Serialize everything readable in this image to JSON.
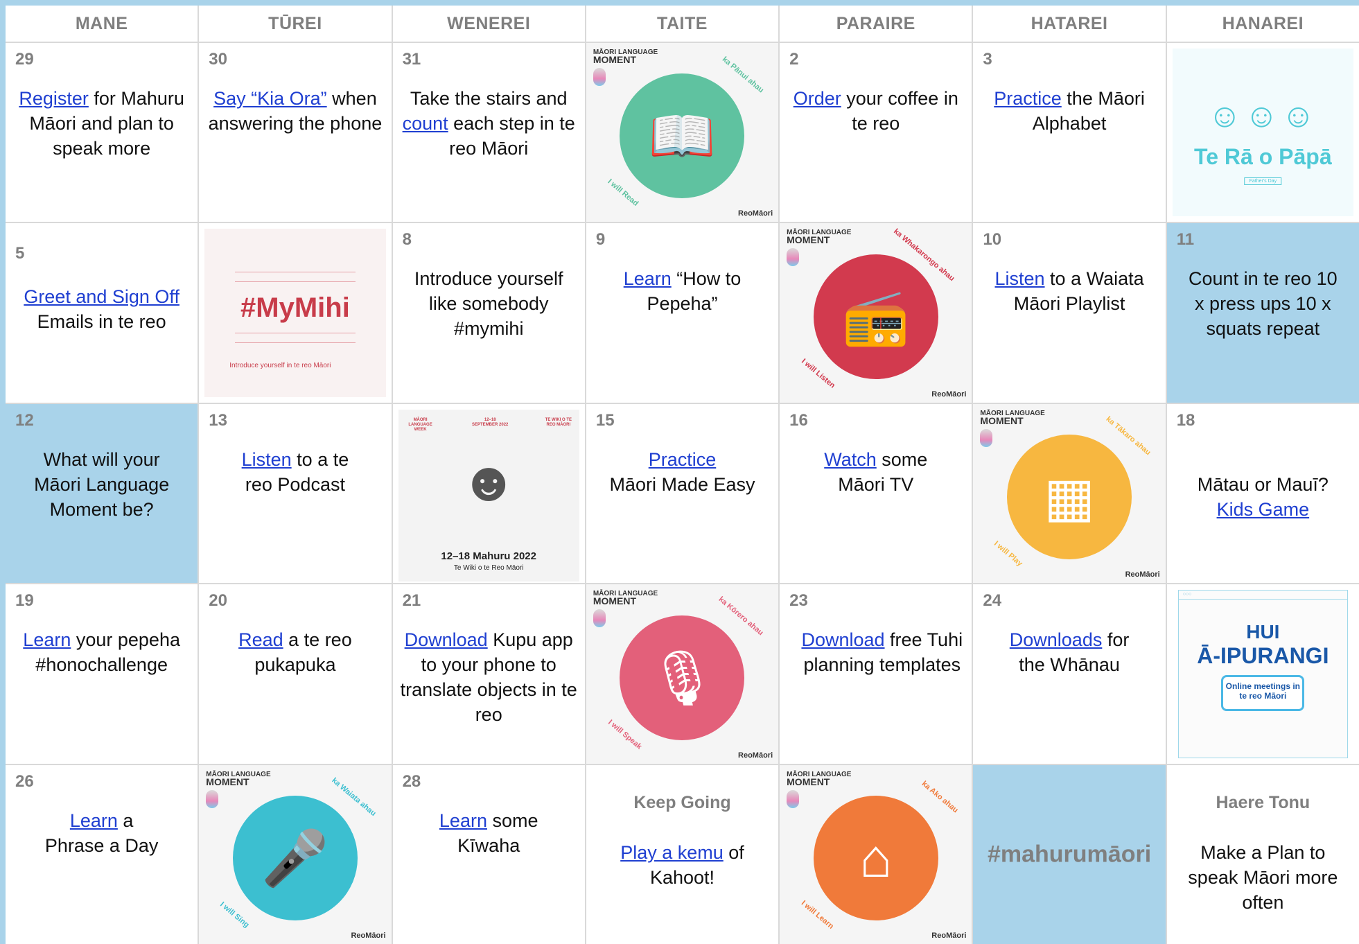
{
  "headers": [
    "MANE",
    "TŪREI",
    "WENEREI",
    "TAITE",
    "PARAIRE",
    "HATAREI",
    "HANAREI"
  ],
  "colors": {
    "accent_blue": "#a9d3ea",
    "link": "#1f3fd1",
    "grey_text": "#7f7f7f"
  },
  "moment": {
    "label_small": "MĀORI LANGUAGE",
    "label_big": "MOMENT",
    "brand": "ReoMāori"
  },
  "cells": {
    "c29": {
      "day": "29",
      "link": "Register",
      "rest": " for Mahuru Māori and plan to speak more"
    },
    "c30": {
      "day": "30",
      "link": "Say “Kia Ora”",
      "rest": " when answering the phone"
    },
    "c31": {
      "day": "31",
      "pre": "Take the stairs and ",
      "link": "count",
      "rest": " each step in te reo Māori"
    },
    "read": {
      "arc1": "ka Pānui ahau",
      "arc2": "I will Read",
      "color": "#5fc2a0",
      "icon": "open-book-icon"
    },
    "c2": {
      "day": "2",
      "link": "Order",
      "rest": " your coffee in te reo"
    },
    "c3": {
      "day": "3",
      "link": "Practice",
      "rest": " the Māori Alphabet"
    },
    "fathers": {
      "title": "Te Rā o Pāpā",
      "sub": "Father's Day"
    },
    "c5": {
      "day": "5",
      "link": "Greet and Sign Off",
      "rest": " Emails in te reo"
    },
    "mihi": {
      "title": "#MyMihi",
      "caption": "Introduce yourself in te reo Māori"
    },
    "c8": {
      "day": "8",
      "text": "Introduce yourself like somebody #mymihi"
    },
    "c9": {
      "day": "9",
      "link": "Learn",
      "rest": " “How to Pepeha”"
    },
    "listen": {
      "arc1": "ka Whakarongo ahau",
      "arc2": "I will Listen",
      "color": "#d23a4e",
      "icon": "radio-icon"
    },
    "c10": {
      "day": "10",
      "link": "Listen",
      "rest": " to a Waiata Māori Playlist"
    },
    "c11": {
      "day": "11",
      "text": "Count in te reo 10 x press ups 10 x squats repeat"
    },
    "c12": {
      "day": "12",
      "text": "What will your Māori Language Moment be?"
    },
    "c13": {
      "day": "13",
      "link": "Listen",
      "rest": " to a te reo Podcast"
    },
    "poster": {
      "top_left": "MĀORI LANGUAGE WEEK",
      "top_mid": "12–18 SEPTEMBER 2022",
      "top_right": "TE WIKI O TE REO MĀORI",
      "title": "12–18 Mahuru 2022",
      "sub": "Te Wiki o te Reo Māori"
    },
    "c15": {
      "day": "15",
      "link": "Practice",
      "rest": " Māori Made Easy"
    },
    "c16": {
      "day": "16",
      "link": "Watch",
      "rest": " some Māori TV"
    },
    "play": {
      "arc1": "ka Tākaro ahau",
      "arc2": "I will Play",
      "color": "#f7b740",
      "icon": "cube-icon"
    },
    "c18": {
      "day": "18",
      "pre": "Mātau or Mauī? ",
      "link": "Kids Game"
    },
    "c19": {
      "day": "19",
      "link": "Learn",
      "rest": " your pepeha #honochallenge"
    },
    "c20": {
      "day": "20",
      "link": "Read",
      "rest": " a te reo pukapuka"
    },
    "c21": {
      "day": "21",
      "link": "Download",
      "rest": " Kupu app to your phone to translate objects in te reo"
    },
    "speak": {
      "arc1": "ka Kōrero ahau",
      "arc2": "I will Speak",
      "color": "#e3607a",
      "icon": "microphone-icon"
    },
    "c23": {
      "day": "23",
      "link": "Download",
      "rest": " free Tuhi planning templates"
    },
    "c24": {
      "day": "24",
      "link": "Downloads",
      "rest": " for the Whānau"
    },
    "hui": {
      "line1": "HUI",
      "line2": "Ā-IPURANGI",
      "line3": "Online meetings in te reo Māori"
    },
    "c26": {
      "day": "26",
      "link": "Learn",
      "rest": " a Phrase a Day"
    },
    "sing": {
      "arc1": "ka Waiata ahau",
      "arc2": "I will Sing",
      "color": "#3cbfd0",
      "icon": "handheld-mic-icon"
    },
    "c28": {
      "day": "28",
      "link": "Learn",
      "rest": " some Kīwaha"
    },
    "keep": {
      "title": "Keep Going",
      "link": "Play a kemu",
      "rest": " of Kahoot!"
    },
    "learn": {
      "arc1": "ka Ako ahau",
      "arc2": "I will Learn",
      "color": "#f07a3a",
      "icon": "meeting-house-icon"
    },
    "hashtag": {
      "text": "#mahurumāori"
    },
    "haere": {
      "title": "Haere Tonu",
      "text": "Make a Plan to speak Māori more often"
    }
  }
}
